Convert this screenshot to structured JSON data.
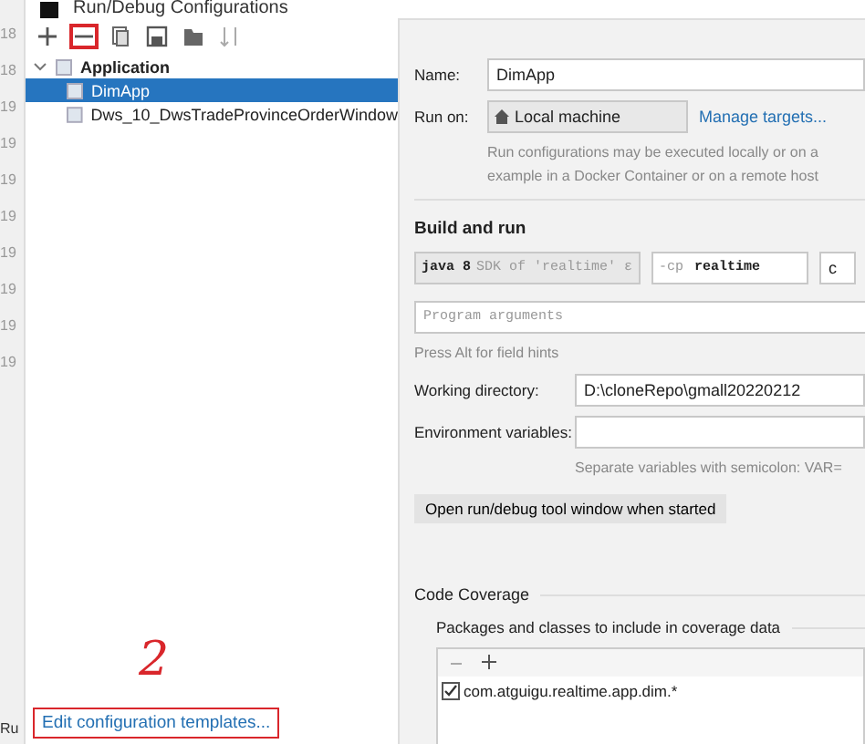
{
  "window": {
    "title": "Run/Debug Configurations"
  },
  "gutter": {
    "line_numbers": [
      "18",
      "18",
      "19",
      "19",
      "19",
      "19",
      "19",
      "19",
      "19",
      "19"
    ],
    "tool_label": "Ru"
  },
  "toolbar": [
    {
      "kind": "add",
      "selected": false
    },
    {
      "kind": "remove",
      "selected": true
    },
    {
      "kind": "copy",
      "selected": false
    },
    {
      "kind": "save",
      "selected": false
    },
    {
      "kind": "folder",
      "selected": false
    },
    {
      "kind": "sort",
      "selected": false
    }
  ],
  "tree": [
    {
      "label": "Application",
      "expanded": true,
      "selected": false,
      "children": [
        {
          "label": "DimApp",
          "selected": true
        },
        {
          "label": "Dws_10_DwsTradeProvinceOrderWindow",
          "selected": false
        }
      ]
    }
  ],
  "templates_link": {
    "label": "Edit configuration templates...",
    "highlighted": true
  },
  "annotation": {
    "label": "2"
  },
  "form": {
    "name_label": "Name:",
    "name_value": "DimApp",
    "run_on_label": "Run on:",
    "run_on_value": "Local machine",
    "manage_link": "Manage targets...",
    "run_on_help": [
      "Run configurations may be executed locally or on a",
      "example in a Docker Container or on a remote host"
    ],
    "section": "Build and run",
    "jdk": {
      "value": "java 8",
      "hint": "SDK of 'realtime' ε"
    },
    "classpath": {
      "prefix": "-cp",
      "value": "realtime"
    },
    "main_class_cut": "c",
    "program_args": {
      "placeholder": "Program arguments"
    },
    "field_hint": "Press Alt for field hints",
    "working_dir_label": "Working directory:",
    "working_dir_value": "D:\\cloneRepo\\gmall20220212",
    "env_label": "Environment variables:",
    "env_help": "Separate variables with semicolon: VAR=",
    "option_chip": "Open run/debug tool window when started"
  },
  "coverage": {
    "title": "Code Coverage",
    "subtitle": "Packages and classes to include in coverage data",
    "entries": [
      {
        "label": "com.atguigu.realtime.app.dim.*",
        "checked": true
      }
    ]
  }
}
